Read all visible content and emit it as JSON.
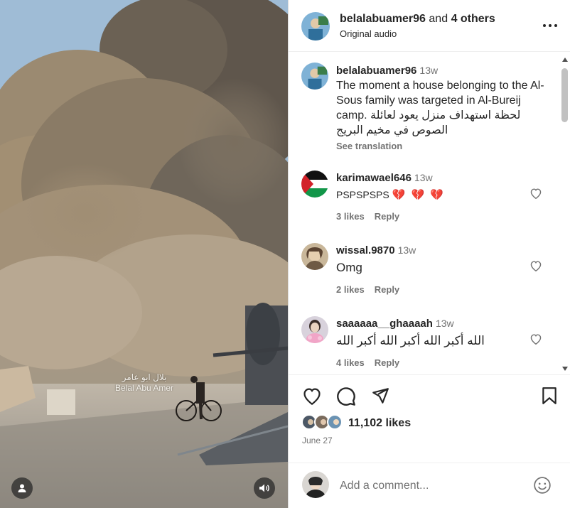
{
  "post": {
    "author": "belalabuamer96",
    "and_text": "and",
    "others": "4 others",
    "audio": "Original audio"
  },
  "media": {
    "watermark_ar": "بلال ابو عامر",
    "watermark_en": "Belal Abu Amer"
  },
  "caption": {
    "user": "belalabuamer96",
    "time": "13w",
    "text_en": "The moment a house belonging to the Al-Sous family was targeted in Al-Bureij camp.",
    "text_ar": "لحظة استهداف منزل يعود لعائلة الصوص في مخيم البريج",
    "see_translation": "See translation"
  },
  "comments": [
    {
      "user": "karimawael646",
      "time": "13w",
      "text": "PSPSPSPS",
      "emoji": "💔 💔 💔",
      "likes": "3 likes",
      "reply": "Reply"
    },
    {
      "user": "wissal.9870",
      "time": "13w",
      "text": "Omg",
      "emoji": "",
      "likes": "2 likes",
      "reply": "Reply"
    },
    {
      "user": "saaaaaa__ghaaaah",
      "time": "13w",
      "text": "الله أكبر الله أكبر الله أكبر الله",
      "emoji": "",
      "likes": "4 likes",
      "reply": "Reply"
    }
  ],
  "stats": {
    "likes": "11,102 likes",
    "date": "June 27"
  },
  "composer": {
    "placeholder": "Add a comment..."
  },
  "colors": {
    "text": "#262626",
    "secondary": "#737373",
    "border": "#dbdbdb",
    "heart_emoji": "#e0245e"
  },
  "icons": {
    "more": "more-horizontal-icon",
    "like": "heart-icon",
    "comment": "comment-icon",
    "share": "send-icon",
    "save": "bookmark-icon",
    "emoji": "smiley-icon",
    "user_tag": "user-icon",
    "sound": "speaker-icon"
  }
}
